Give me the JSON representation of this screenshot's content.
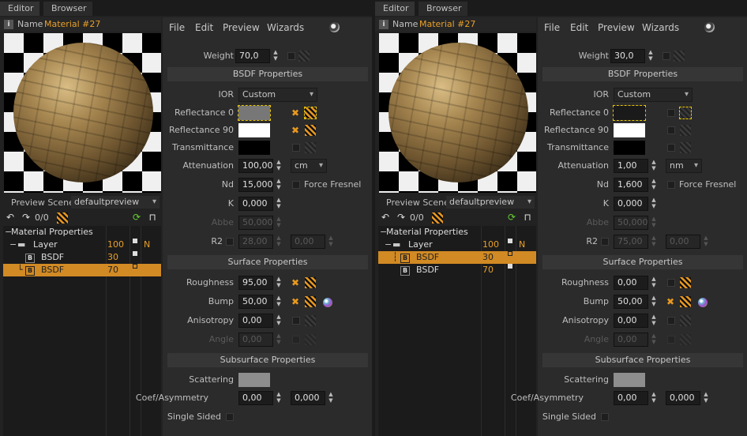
{
  "tabs": {
    "editor": "Editor",
    "browser": "Browser"
  },
  "name_label": "Name",
  "material_name": "Material #27",
  "preview_scene_label": "Preview Scene",
  "preview_scene_value": "defaultpreview",
  "counter": "0/0",
  "menu": {
    "file": "File",
    "edit": "Edit",
    "preview": "Preview",
    "wizards": "Wizards"
  },
  "tree": {
    "root": "Material Properties",
    "layer": "Layer",
    "layer_weight": "100",
    "layer_flag": "N",
    "bsdf": "BSDF",
    "b_icon": "B"
  },
  "sections": {
    "bsdf": "BSDF Properties",
    "surface": "Surface Properties",
    "subsurface": "Subsurface Properties"
  },
  "labels": {
    "weight": "Weight",
    "ior": "IOR",
    "refl0": "Reflectance 0",
    "refl90": "Reflectance 90",
    "transmittance": "Transmittance",
    "attenuation": "Attenuation",
    "nd": "Nd",
    "force_fresnel": "Force Fresnel",
    "k": "K",
    "abbe": "Abbe",
    "r2": "R2",
    "roughness": "Roughness",
    "bump": "Bump",
    "anisotropy": "Anisotropy",
    "angle": "Angle",
    "scattering": "Scattering",
    "coef": "Coef/Asymmetry",
    "single_sided": "Single Sided"
  },
  "ior_value": "Custom",
  "colors": {
    "accent": "#e8a02a",
    "selection": "#d18a24"
  },
  "editors": [
    {
      "bsdf_rows": [
        {
          "weight": "30"
        },
        {
          "weight": "70"
        }
      ],
      "selected_row": 1,
      "weight": "70,0",
      "attenuation": "100,00",
      "att_unit": "cm",
      "nd": "15,000",
      "k": "0,000",
      "abbe": "50,000",
      "r2a": "28,00",
      "r2b": "0,00",
      "roughness": "95,00",
      "bump": "50,00",
      "anisotropy": "0,00",
      "angle": "0,00",
      "coef_a": "0,00",
      "coef_b": "0,000"
    },
    {
      "bsdf_rows": [
        {
          "weight": "30"
        },
        {
          "weight": "70"
        }
      ],
      "selected_row": 0,
      "weight": "30,0",
      "attenuation": "1,00",
      "att_unit": "nm",
      "nd": "1,600",
      "k": "0,000",
      "abbe": "50,000",
      "r2a": "75,00",
      "r2b": "0,00",
      "roughness": "0,00",
      "bump": "50,00",
      "anisotropy": "0,00",
      "angle": "0,00",
      "coef_a": "0,00",
      "coef_b": "0,000"
    }
  ]
}
